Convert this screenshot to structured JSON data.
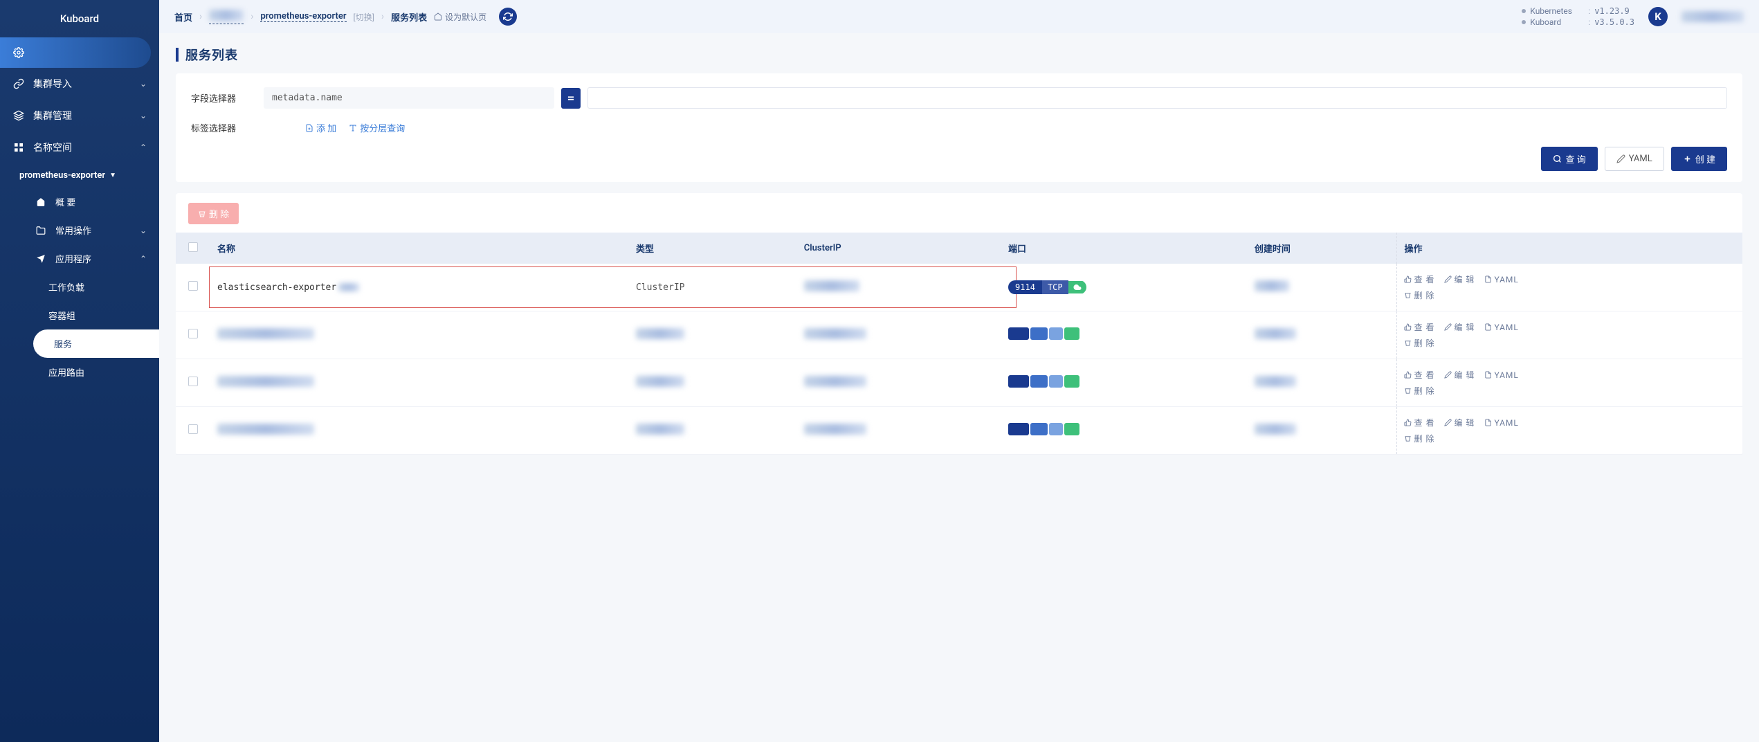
{
  "app": {
    "name": "Kuboard"
  },
  "sidebar": {
    "selected_label": "",
    "items": {
      "import": "集群导入",
      "manage": "集群管理",
      "namespace": "名称空间",
      "namespace_current": "prometheus-exporter",
      "overview": "概 要",
      "common_ops": "常用操作",
      "applications": "应用程序",
      "workloads": "工作负载",
      "pods": "容器组",
      "services": "服务",
      "ingress": "应用路由"
    }
  },
  "breadcrumb": {
    "home": "首页",
    "cluster": "",
    "namespace": "prometheus-exporter",
    "switch": "[切换]",
    "current": "服务列表",
    "set_default": "设为默认页"
  },
  "versions": {
    "k8s_name": "Kubernetes",
    "k8s_ver": "v1.23.9",
    "kb_name": "Kuboard",
    "kb_ver": "v3.5.0.3"
  },
  "user_initial": "K",
  "page": {
    "title": "服务列表"
  },
  "filters": {
    "field_label": "字段选择器",
    "field_value": "metadata.name",
    "eq": "=",
    "label_label": "标签选择器",
    "add": "添 加",
    "group_query": "按分层查询"
  },
  "buttons": {
    "query": "查 询",
    "yaml": "YAML",
    "create": "创 建",
    "delete": "删 除"
  },
  "table": {
    "headers": {
      "name": "名称",
      "type": "类型",
      "cluster_ip": "ClusterIP",
      "port": "端口",
      "created": "创建时间",
      "ops": "操作"
    },
    "ops": {
      "view": "查 看",
      "edit": "编 辑",
      "yaml": "YAML",
      "delete": "删 除"
    },
    "rows": [
      {
        "name": "elasticsearch-exporter",
        "type": "ClusterIP",
        "port": "9114",
        "proto": "TCP",
        "highlighted": true
      },
      {
        "blurred": true
      },
      {
        "blurred": true
      },
      {
        "blurred": true
      }
    ]
  }
}
